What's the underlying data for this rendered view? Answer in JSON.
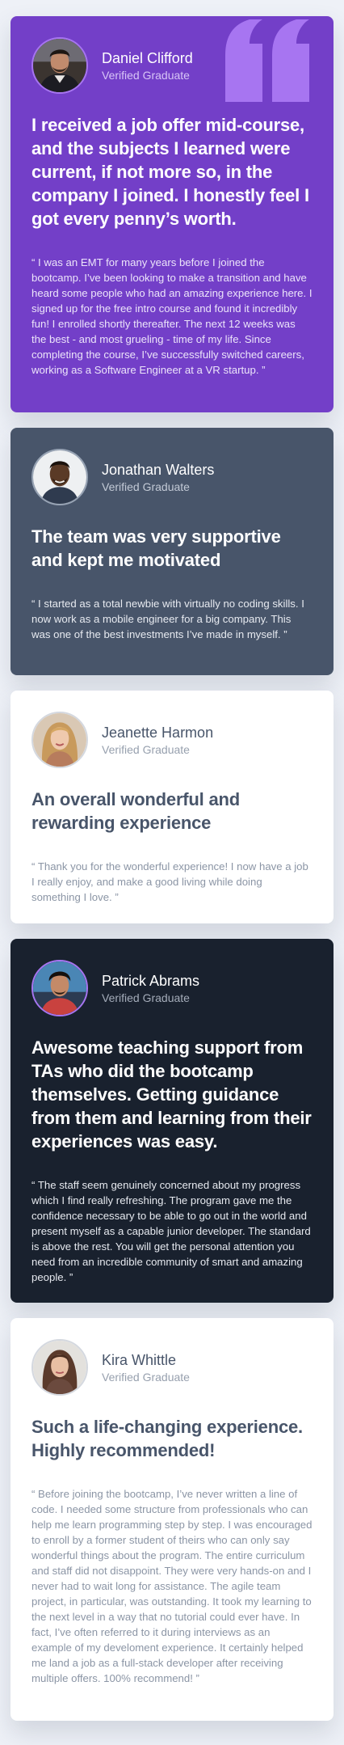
{
  "colors": {
    "violet": "#733fc8",
    "grayish_blue": "#48556a",
    "very_dark_blue": "#19212e",
    "white": "#ffffff",
    "page_background": "#eef1f7",
    "quote_mark": "#a775f1"
  },
  "testimonials": [
    {
      "name": "Daniel Clifford",
      "role": "Verified Graduate",
      "headline": "I received a job offer mid-course, and the subjects I learned were current, if not more so, in the company I joined. I honestly feel I got every penny’s worth.",
      "quote": "“ I was an EMT for many years before I joined the bootcamp. I’ve been looking to make a transition and have heard some people who had an amazing experience here. I signed up for the free intro course and found it incredibly fun! I enrolled shortly thereafter. The next 12 weeks was the best - and most grueling - time of my life. Since completing the course, I’ve successfully switched careers, working as a Software Engineer at a VR startup. ”",
      "icon": "quotation-mark-icon"
    },
    {
      "name": "Jonathan Walters",
      "role": "Verified Graduate",
      "headline": "The team was very supportive and kept me motivated",
      "quote": "“ I started as a total newbie with virtually no coding skills. I now work as a mobile engineer for a big company. This was one of the best investments I’ve made in myself. ”"
    },
    {
      "name": "Jeanette Harmon",
      "role": "Verified Graduate",
      "headline": "An overall wonderful and rewarding experience",
      "quote": "“ Thank you for the wonderful experience! I now have a job I really enjoy, and make a good living while doing something I love. ”"
    },
    {
      "name": "Patrick Abrams",
      "role": "Verified Graduate",
      "headline": "Awesome teaching support from TAs who did the bootcamp themselves. Getting guidance from them and learning from their experiences was easy.",
      "quote": "“ The staff seem genuinely concerned about my progress which I find really refreshing. The program gave me the confidence necessary to be able to go out in the world and present myself as a capable junior developer. The standard is above the rest. You will get the personal attention you need from an incredible community of smart and amazing people. ”"
    },
    {
      "name": "Kira Whittle",
      "role": "Verified Graduate",
      "headline": "Such a life-changing experience. Highly recommended!",
      "quote": "“ Before joining the bootcamp, I’ve never written a line of code. I needed some structure from professionals who can help me learn programming step by step. I was encouraged to enroll by a former student of theirs who can only say wonderful things about the program. The entire curriculum and staff did not disappoint. They were very hands-on and I never had to wait long for assistance. The agile team project, in particular, was outstanding. It took my learning to the next level in a way that no tutorial could ever have. In fact, I’ve often referred to it during interviews as an example of my develoment experience. It certainly helped me land a job as a full-stack developer after receiving multiple offers. 100% recommend! ”"
    }
  ]
}
